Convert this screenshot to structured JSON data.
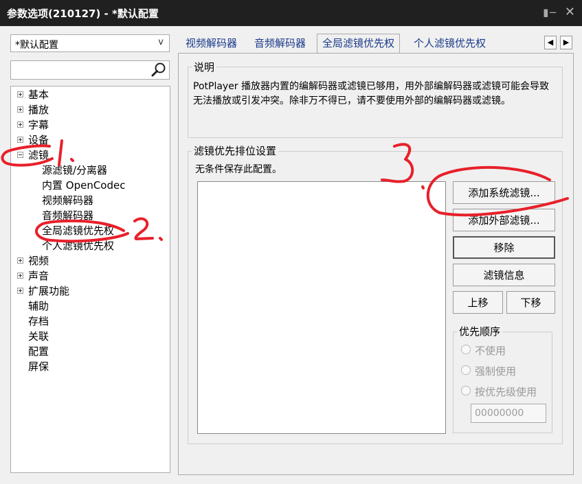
{
  "window": {
    "title": "参数选项(210127) - *默认配置",
    "pin_icon": "pin-icon",
    "close_icon": "close-icon"
  },
  "left": {
    "profile_select": {
      "value": "*默认配置",
      "arrow": "v"
    },
    "search": {
      "value": "",
      "placeholder": "",
      "icon": "search-icon"
    },
    "tree": [
      {
        "label": "基本",
        "expander": "plus"
      },
      {
        "label": "播放",
        "expander": "plus"
      },
      {
        "label": "字幕",
        "expander": "plus"
      },
      {
        "label": "设备",
        "expander": "plus"
      },
      {
        "label": "滤镜",
        "expander": "minus"
      },
      {
        "label": "源滤镜/分离器",
        "expander": ""
      },
      {
        "label": "内置 OpenCodec",
        "expander": ""
      },
      {
        "label": "视频解码器",
        "expander": ""
      },
      {
        "label": "音频解码器",
        "expander": ""
      },
      {
        "label": "全局滤镜优先权",
        "expander": ""
      },
      {
        "label": "个人滤镜优先权",
        "expander": ""
      },
      {
        "label": "视频",
        "expander": "plus"
      },
      {
        "label": "声音",
        "expander": "plus"
      },
      {
        "label": "扩展功能",
        "expander": "plus"
      },
      {
        "label": "辅助",
        "expander": ""
      },
      {
        "label": "存档",
        "expander": ""
      },
      {
        "label": "关联",
        "expander": ""
      },
      {
        "label": "配置",
        "expander": ""
      },
      {
        "label": "屏保",
        "expander": ""
      }
    ]
  },
  "tabs": [
    {
      "label": "视频解码器",
      "active": false
    },
    {
      "label": "音频解码器",
      "active": false
    },
    {
      "label": "全局滤镜优先权",
      "active": true
    },
    {
      "label": "个人滤镜优先权",
      "active": false
    }
  ],
  "tab_scroll": {
    "left": "◀",
    "right": "▶"
  },
  "description": {
    "title": "说明",
    "text": "PotPlayer 播放器内置的编解码器或滤镜已够用，用外部编解码器或滤镜可能会导致无法播放或引发冲突。除非万不得已，请不要使用外部的编解码器或滤镜。"
  },
  "priority_settings": {
    "title": "滤镜优先排位设置",
    "note": "无条件保存此配置。",
    "buttons": {
      "add_system": "添加系统滤镜...",
      "add_external": "添加外部滤镜...",
      "remove": "移除",
      "filter_info": "滤镜信息",
      "move_up": "上移",
      "move_down": "下移"
    },
    "order": {
      "title": "优先顺序",
      "options": [
        "不使用",
        "强制使用",
        "按优先级使用"
      ],
      "value": "00000000"
    }
  },
  "annotations": {
    "color": "#e8202a",
    "labels": [
      "1.",
      "2.",
      "3."
    ]
  }
}
